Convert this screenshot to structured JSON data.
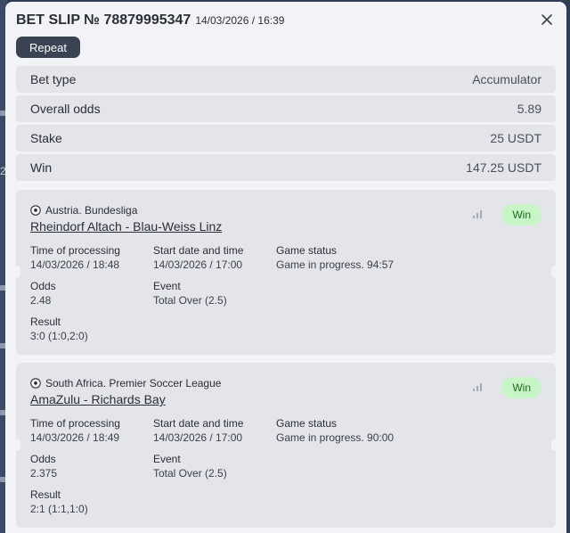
{
  "header": {
    "title": "BET SLIP № 78879995347",
    "datetime": "14/03/2026 / 16:39"
  },
  "buttons": {
    "repeat_label": "Repeat"
  },
  "background": {
    "edge_number": "2"
  },
  "summary": [
    {
      "label": "Bet type",
      "value": "Accumulator"
    },
    {
      "label": "Overall odds",
      "value": "5.89"
    },
    {
      "label": "Stake",
      "value": "25 USDT"
    },
    {
      "label": "Win",
      "value": "147.25 USDT"
    }
  ],
  "events": [
    {
      "league": "Austria. Bundesliga",
      "match": "Rheindorf Altach - Blau-Weiss Linz",
      "status_badge": "Win",
      "time_of_processing_label": "Time of processing",
      "time_of_processing": "14/03/2026 / 18:48",
      "start_label": "Start date and time",
      "start": "14/03/2026 / 17:00",
      "game_status_label": "Game status",
      "game_status": "Game in progress. 94:57",
      "odds_label": "Odds",
      "odds": "2.48",
      "event_label": "Event",
      "event": "Total Over (2.5)",
      "result_label": "Result",
      "result": "3:0 (1:0,2:0)"
    },
    {
      "league": "South Africa. Premier Soccer League",
      "match": "AmaZulu - Richards Bay",
      "status_badge": "Win",
      "time_of_processing_label": "Time of processing",
      "time_of_processing": "14/03/2026 / 18:49",
      "start_label": "Start date and time",
      "start": "14/03/2026 / 17:00",
      "game_status_label": "Game status",
      "game_status": "Game in progress. 90:00",
      "odds_label": "Odds",
      "odds": "2.375",
      "event_label": "Event",
      "event": "Total Over (2.5)",
      "result_label": "Result",
      "result": "2:1 (1:1,1:0)"
    }
  ],
  "icons": {
    "close": "close-icon",
    "league": "soccer-ball-icon",
    "stats": "signal-bars-icon"
  },
  "colors": {
    "win_badge_bg": "#c7f5c5",
    "win_badge_text": "#1e6b1e",
    "repeat_button_bg": "#3a4352"
  }
}
